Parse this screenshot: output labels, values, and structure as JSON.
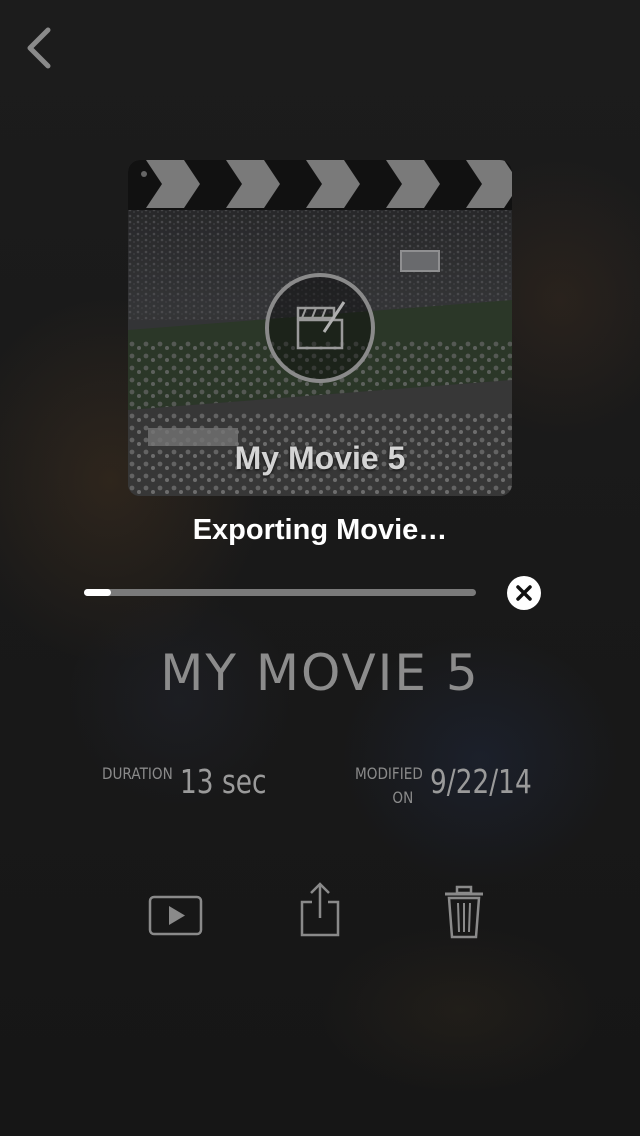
{
  "nav": {
    "back_icon": "chevron-left-icon"
  },
  "thumbnail": {
    "title": "My Movie 5",
    "badge_icon": "clapperboard-edit-icon"
  },
  "export": {
    "status": "Exporting Movie…",
    "progress": 0.07,
    "cancel_icon": "close-icon"
  },
  "movie": {
    "name": "MY MOVIE 5",
    "duration_label": "DURATION",
    "duration_value": "13 sec",
    "modified_label_line1": "MODIFIED",
    "modified_label_line2": "ON",
    "modified_value": "9/22/14"
  },
  "actions": {
    "play_icon": "play-icon",
    "share_icon": "share-icon",
    "delete_icon": "trash-icon"
  }
}
